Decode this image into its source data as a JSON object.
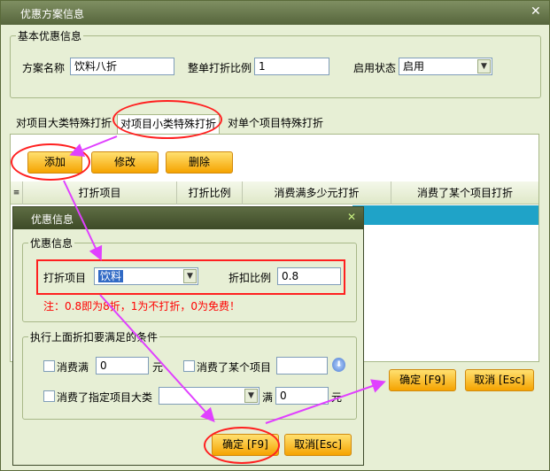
{
  "window": {
    "title": "优惠方案信息",
    "close": "✕"
  },
  "basic": {
    "legend": "基本优惠信息",
    "name_label": "方案名称",
    "name_value": "饮料八折",
    "ratio_label": "整单打折比例",
    "ratio_value": "1",
    "status_label": "启用状态",
    "status_value": "启用"
  },
  "tabs": [
    "对项目大类特殊打折",
    "对项目小类特殊打折",
    "对单个项目特殊打折"
  ],
  "toolbar": {
    "add": "添加",
    "edit": "修改",
    "delete": "删除"
  },
  "table": {
    "columns": [
      "打折项目",
      "打折比例",
      "消费满多少元打折",
      "消费了某个项目打折"
    ]
  },
  "main_buttons": {
    "ok": "确定 [F9]",
    "cancel": "取消 [Esc]"
  },
  "dialog": {
    "title": "优惠信息",
    "close": "✕",
    "group1_legend": "优惠信息",
    "item_label": "打折项目",
    "item_value": "饮料",
    "rate_label": "折扣比例",
    "rate_value": "0.8",
    "note": "注：0.8即为8折，1为不打折，0为免费！",
    "group2_legend": "执行上面折扣要满足的条件",
    "spend_label": "消费满",
    "spend_value": "0",
    "yuan": "元",
    "consumed_item_label": "消费了某个项目",
    "consumed_cat_label": "消费了指定项目大类",
    "man": "满",
    "man_value": "0",
    "yuan2": "元",
    "ok": "确定 [F9]",
    "cancel": "取消[Esc]"
  },
  "colors": {
    "accent": "#f5a300",
    "annotation": "#ff2020",
    "arrow": "#e040ff",
    "selection": "#1fa3c8"
  }
}
